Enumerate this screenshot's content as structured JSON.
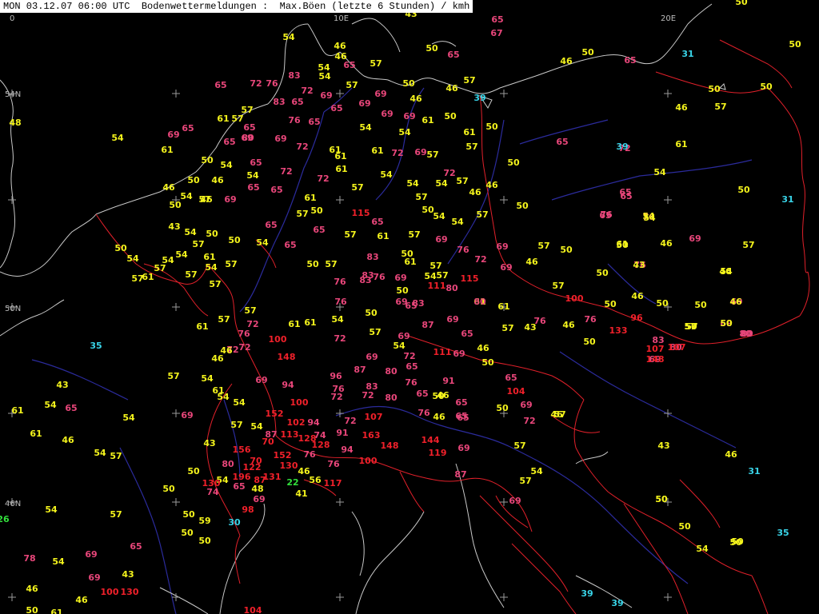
{
  "title": "MON 03.12.07 06:00 UTC  Bodenwettermeldungen :  Max.Böen (letzte 6 Stunden) / kmh",
  "grid_labels": [
    "0",
    "10E",
    "20E",
    "54N",
    "50N",
    "46N"
  ],
  "colors": {
    "background": "#000000",
    "coast": "#c8c8c8",
    "border": "#e0202a",
    "river": "#2b2b9c",
    "grid": "#9a9a9a",
    "low": "#39d4e8",
    "very_low": "#32e03c",
    "moderate": "#f4f41c",
    "strong": "#e8467a",
    "storm": "#f0202a"
  },
  "legend_hidden_note": "",
  "stations": [
    [
      "43",
      "m"
    ],
    [
      "65",
      "s"
    ],
    [
      "67",
      "s"
    ],
    [
      "54",
      "m"
    ],
    [
      "46",
      "m"
    ],
    [
      "46",
      "m"
    ],
    [
      "65",
      "s"
    ],
    [
      "50",
      "m"
    ],
    [
      "65",
      "s"
    ],
    [
      "54",
      "m"
    ],
    [
      "54",
      "m"
    ],
    [
      "57",
      "m"
    ],
    [
      "46",
      "m"
    ],
    [
      "50",
      "m"
    ],
    [
      "65",
      "s"
    ],
    [
      "50",
      "m"
    ],
    [
      "83",
      "s"
    ],
    [
      "57",
      "m"
    ],
    [
      "65",
      "s"
    ],
    [
      "72",
      "s"
    ],
    [
      "76",
      "s"
    ],
    [
      "72",
      "s"
    ],
    [
      "57",
      "m"
    ],
    [
      "50",
      "m"
    ],
    [
      "46",
      "m"
    ],
    [
      "39",
      "l"
    ],
    [
      "48",
      "m"
    ],
    [
      "57",
      "m"
    ],
    [
      "83",
      "s"
    ],
    [
      "65",
      "s"
    ],
    [
      "69",
      "s"
    ],
    [
      "69",
      "s"
    ],
    [
      "69",
      "s"
    ],
    [
      "46",
      "m"
    ],
    [
      "65",
      "s"
    ],
    [
      "65",
      "s"
    ],
    [
      "69",
      "s"
    ],
    [
      "69",
      "s"
    ],
    [
      "61",
      "m"
    ],
    [
      "50",
      "m"
    ],
    [
      "61",
      "m"
    ],
    [
      "50",
      "m"
    ],
    [
      "61",
      "m"
    ],
    [
      "57",
      "m"
    ],
    [
      "65",
      "s"
    ],
    [
      "76",
      "s"
    ],
    [
      "65",
      "s"
    ],
    [
      "69",
      "s"
    ],
    [
      "54",
      "m"
    ],
    [
      "65",
      "s"
    ],
    [
      "80",
      "s"
    ],
    [
      "69",
      "s"
    ],
    [
      "72",
      "s"
    ],
    [
      "61",
      "m"
    ],
    [
      "61",
      "m"
    ],
    [
      "72",
      "s"
    ],
    [
      "69",
      "s"
    ],
    [
      "57",
      "m"
    ],
    [
      "57",
      "m"
    ],
    [
      "61",
      "m"
    ],
    [
      "69",
      "s"
    ],
    [
      "54",
      "m"
    ],
    [
      "54",
      "m"
    ],
    [
      "50",
      "m"
    ],
    [
      "65",
      "s"
    ],
    [
      "54",
      "m"
    ],
    [
      "72",
      "s"
    ],
    [
      "72",
      "s"
    ],
    [
      "61",
      "m"
    ],
    [
      "54",
      "m"
    ],
    [
      "50",
      "m"
    ],
    [
      "46",
      "m"
    ],
    [
      "54",
      "m"
    ],
    [
      "50",
      "m"
    ],
    [
      "61",
      "m"
    ],
    [
      "54",
      "m"
    ],
    [
      "72",
      "s"
    ],
    [
      "65",
      "s"
    ],
    [
      "61",
      "m"
    ],
    [
      "72",
      "s"
    ],
    [
      "57",
      "m"
    ],
    [
      "65",
      "s"
    ],
    [
      "57",
      "m"
    ],
    [
      "46",
      "m"
    ],
    [
      "54",
      "m"
    ],
    [
      "57",
      "m"
    ],
    [
      "54",
      "m"
    ],
    [
      "54",
      "m"
    ],
    [
      "46",
      "m"
    ],
    [
      "46",
      "m"
    ],
    [
      "50",
      "m"
    ],
    [
      "46",
      "m"
    ],
    [
      "69",
      "s"
    ],
    [
      "65",
      "s"
    ],
    [
      "61",
      "m"
    ],
    [
      "57",
      "m"
    ],
    [
      "50",
      "m"
    ],
    [
      "57",
      "m"
    ],
    [
      "54",
      "m"
    ],
    [
      "54",
      "m"
    ],
    [
      "57",
      "m"
    ],
    [
      "50",
      "m"
    ],
    [
      "50",
      "m"
    ],
    [
      "50",
      "m"
    ],
    [
      "115",
      "r"
    ],
    [
      "65",
      "s"
    ],
    [
      "65",
      "s"
    ],
    [
      "76",
      "s"
    ],
    [
      "65",
      "s"
    ],
    [
      "65",
      "s"
    ],
    [
      "57",
      "m"
    ],
    [
      "61",
      "m"
    ],
    [
      "57",
      "m"
    ],
    [
      "69",
      "s"
    ],
    [
      "76",
      "s"
    ],
    [
      "76",
      "s"
    ],
    [
      "83",
      "s"
    ],
    [
      "43",
      "m"
    ],
    [
      "54",
      "m"
    ],
    [
      "50",
      "m"
    ],
    [
      "57",
      "m"
    ],
    [
      "50",
      "m"
    ],
    [
      "54",
      "m"
    ],
    [
      "50",
      "m"
    ],
    [
      "57",
      "m"
    ],
    [
      "61",
      "m"
    ],
    [
      "54",
      "m"
    ],
    [
      "57",
      "m"
    ],
    [
      "69",
      "s"
    ],
    [
      "69",
      "s"
    ],
    [
      "46",
      "m"
    ],
    [
      "65",
      "s"
    ],
    [
      "50",
      "m"
    ],
    [
      "72",
      "s"
    ],
    [
      "50",
      "m"
    ],
    [
      "57",
      "m"
    ],
    [
      "50",
      "m"
    ],
    [
      "50",
      "m"
    ],
    [
      "76",
      "s"
    ],
    [
      "83",
      "s"
    ],
    [
      "76",
      "s"
    ],
    [
      "69",
      "s"
    ],
    [
      "61",
      "m"
    ],
    [
      "57",
      "m"
    ],
    [
      "111",
      "r"
    ],
    [
      "80",
      "s"
    ],
    [
      "115",
      "r"
    ],
    [
      "76",
      "s"
    ],
    [
      "50",
      "m"
    ],
    [
      "54",
      "m"
    ],
    [
      "57",
      "m"
    ],
    [
      "61",
      "m"
    ],
    [
      "54",
      "m"
    ],
    [
      "57",
      "m"
    ],
    [
      "54",
      "m"
    ],
    [
      "50",
      "m"
    ],
    [
      "57",
      "m"
    ],
    [
      "57",
      "m"
    ],
    [
      "54",
      "m"
    ],
    [
      "54",
      "m"
    ],
    [
      "57",
      "m"
    ],
    [
      "61",
      "m"
    ],
    [
      "83",
      "s"
    ],
    [
      "57",
      "m"
    ],
    [
      "80",
      "s"
    ],
    [
      "61",
      "m"
    ],
    [
      "100",
      "r"
    ],
    [
      "57",
      "m"
    ],
    [
      "50",
      "m"
    ],
    [
      "46",
      "m"
    ],
    [
      "50",
      "m"
    ],
    [
      "69",
      "s"
    ],
    [
      "35",
      "l"
    ],
    [
      "61",
      "m"
    ],
    [
      "57",
      "m"
    ],
    [
      "72",
      "s"
    ],
    [
      "100",
      "r"
    ],
    [
      "61",
      "m"
    ],
    [
      "57",
      "m"
    ],
    [
      "61",
      "m"
    ],
    [
      "54",
      "m"
    ],
    [
      "50",
      "m"
    ],
    [
      "87",
      "s"
    ],
    [
      "69",
      "s"
    ],
    [
      "65",
      "s"
    ],
    [
      "57",
      "m"
    ],
    [
      "43",
      "m"
    ],
    [
      "76",
      "s"
    ],
    [
      "46",
      "m"
    ],
    [
      "76",
      "s"
    ],
    [
      "133",
      "r"
    ],
    [
      "96",
      "r"
    ],
    [
      "57",
      "m"
    ],
    [
      "50",
      "m"
    ],
    [
      "80",
      "s"
    ],
    [
      "76",
      "s"
    ],
    [
      "69",
      "s"
    ],
    [
      "65",
      "s"
    ],
    [
      "76",
      "s"
    ],
    [
      "72",
      "s"
    ],
    [
      "57",
      "m"
    ],
    [
      "69",
      "s"
    ],
    [
      "83",
      "s"
    ],
    [
      "107",
      "r"
    ],
    [
      "50",
      "m"
    ],
    [
      "80",
      "s"
    ],
    [
      "69",
      "s"
    ],
    [
      "72",
      "s"
    ],
    [
      "54",
      "m"
    ],
    [
      "72",
      "s"
    ],
    [
      "111",
      "r"
    ],
    [
      "69",
      "s"
    ],
    [
      "46",
      "m"
    ],
    [
      "50",
      "m"
    ],
    [
      "69",
      "s"
    ],
    [
      "148",
      "r"
    ],
    [
      "46",
      "m"
    ],
    [
      "87",
      "s"
    ],
    [
      "80",
      "s"
    ],
    [
      "72",
      "s"
    ],
    [
      "65",
      "s"
    ],
    [
      "96",
      "s"
    ],
    [
      "91",
      "s"
    ],
    [
      "65",
      "s"
    ],
    [
      "46",
      "m"
    ],
    [
      "50",
      "m"
    ],
    [
      "65",
      "s"
    ],
    [
      "69",
      "s"
    ],
    [
      "94",
      "s"
    ],
    [
      "76",
      "s"
    ],
    [
      "83",
      "s"
    ],
    [
      "72",
      "s"
    ],
    [
      "76",
      "s"
    ],
    [
      "104",
      "r"
    ],
    [
      "54",
      "m"
    ],
    [
      "54",
      "m"
    ],
    [
      "46",
      "m"
    ],
    [
      "69",
      "s"
    ],
    [
      "100",
      "r"
    ],
    [
      "72",
      "s"
    ],
    [
      "80",
      "s"
    ],
    [
      "65",
      "s"
    ],
    [
      "65",
      "s"
    ],
    [
      "50",
      "m"
    ],
    [
      "61",
      "m"
    ],
    [
      "54",
      "m"
    ],
    [
      "65",
      "s"
    ],
    [
      "57",
      "m"
    ],
    [
      "61",
      "m"
    ],
    [
      "54",
      "m"
    ],
    [
      "43",
      "m"
    ],
    [
      "54",
      "m"
    ],
    [
      "152",
      "r"
    ],
    [
      "72",
      "s"
    ],
    [
      "107",
      "r"
    ],
    [
      "76",
      "s"
    ],
    [
      "46",
      "m"
    ],
    [
      "65",
      "s"
    ],
    [
      "72",
      "s"
    ],
    [
      "57",
      "m"
    ],
    [
      "69",
      "s"
    ],
    [
      "57",
      "m"
    ],
    [
      "54",
      "m"
    ],
    [
      "102",
      "r"
    ],
    [
      "94",
      "s"
    ],
    [
      "113",
      "r"
    ],
    [
      "74",
      "s"
    ],
    [
      "91",
      "s"
    ],
    [
      "87",
      "s"
    ],
    [
      "128",
      "r"
    ],
    [
      "128",
      "r"
    ],
    [
      "163",
      "r"
    ],
    [
      "148",
      "r"
    ],
    [
      "144",
      "r"
    ],
    [
      "69",
      "s"
    ],
    [
      "61",
      "m"
    ],
    [
      "46",
      "m"
    ],
    [
      "43",
      "m"
    ],
    [
      "156",
      "r"
    ],
    [
      "70",
      "r"
    ],
    [
      "94",
      "s"
    ],
    [
      "119",
      "r"
    ],
    [
      "54",
      "m"
    ],
    [
      "57",
      "m"
    ],
    [
      "57",
      "m"
    ],
    [
      "46",
      "m"
    ],
    [
      "70",
      "r"
    ],
    [
      "152",
      "r"
    ],
    [
      "76",
      "s"
    ],
    [
      "76",
      "s"
    ],
    [
      "100",
      "r"
    ],
    [
      "50",
      "m"
    ],
    [
      "80",
      "s"
    ],
    [
      "122",
      "r"
    ],
    [
      "130",
      "r"
    ],
    [
      "46",
      "m"
    ],
    [
      "54",
      "m"
    ],
    [
      "50",
      "m"
    ],
    [
      "196",
      "r"
    ],
    [
      "87",
      "r"
    ],
    [
      "131",
      "r"
    ],
    [
      "22",
      "v"
    ],
    [
      "56",
      "m"
    ],
    [
      "87",
      "s"
    ],
    [
      "57",
      "m"
    ],
    [
      "130",
      "r"
    ],
    [
      "65",
      "s"
    ],
    [
      "48",
      "m"
    ],
    [
      "117",
      "r"
    ],
    [
      "74",
      "s"
    ],
    [
      "69",
      "s"
    ],
    [
      "41",
      "m"
    ],
    [
      "69",
      "s"
    ],
    [
      "54",
      "m"
    ],
    [
      "98",
      "r"
    ],
    [
      "57",
      "m"
    ],
    [
      "50",
      "m"
    ],
    [
      "59",
      "m"
    ],
    [
      "30",
      "l"
    ],
    [
      "50",
      "m"
    ],
    [
      "26",
      "v"
    ],
    [
      "65",
      "s"
    ],
    [
      "54",
      "m"
    ],
    [
      "78",
      "s"
    ],
    [
      "69",
      "s"
    ],
    [
      "43",
      "m"
    ],
    [
      "69",
      "s"
    ],
    [
      "46",
      "m"
    ],
    [
      "100",
      "r"
    ],
    [
      "130",
      "r"
    ],
    [
      "46",
      "m"
    ],
    [
      "50",
      "m"
    ],
    [
      "61",
      "m"
    ],
    [
      "104",
      "r"
    ],
    [
      "50",
      "m"
    ],
    [
      "31",
      "l"
    ],
    [
      "54",
      "m"
    ],
    [
      "43",
      "m"
    ],
    [
      "46",
      "m"
    ],
    [
      "50",
      "m"
    ],
    [
      "50",
      "m"
    ],
    [
      "50",
      "m"
    ],
    [
      "65",
      "s"
    ],
    [
      "50",
      "m"
    ],
    [
      "39",
      "l"
    ],
    [
      "46",
      "m"
    ],
    [
      "57",
      "m"
    ],
    [
      "54",
      "m"
    ],
    [
      "31",
      "l"
    ],
    [
      "65",
      "s"
    ],
    [
      "69",
      "s"
    ],
    [
      "54",
      "m"
    ],
    [
      "46",
      "m"
    ],
    [
      "61",
      "m"
    ],
    [
      "43",
      "m"
    ],
    [
      "46",
      "m"
    ],
    [
      "50",
      "m"
    ],
    [
      "46",
      "m"
    ],
    [
      "69",
      "s"
    ],
    [
      "50",
      "m"
    ],
    [
      "57",
      "m"
    ],
    [
      "50",
      "m"
    ],
    [
      "80",
      "s"
    ],
    [
      "83",
      "s"
    ],
    [
      "107",
      "r"
    ],
    [
      "148",
      "r"
    ],
    [
      "50",
      "m"
    ],
    [
      "31",
      "l"
    ],
    [
      "50",
      "m"
    ],
    [
      "35",
      "l"
    ],
    [
      "54",
      "m"
    ],
    [
      "50",
      "m"
    ],
    [
      "39",
      "l"
    ],
    [
      "39",
      "l"
    ],
    [
      "50",
      "m"
    ]
  ]
}
